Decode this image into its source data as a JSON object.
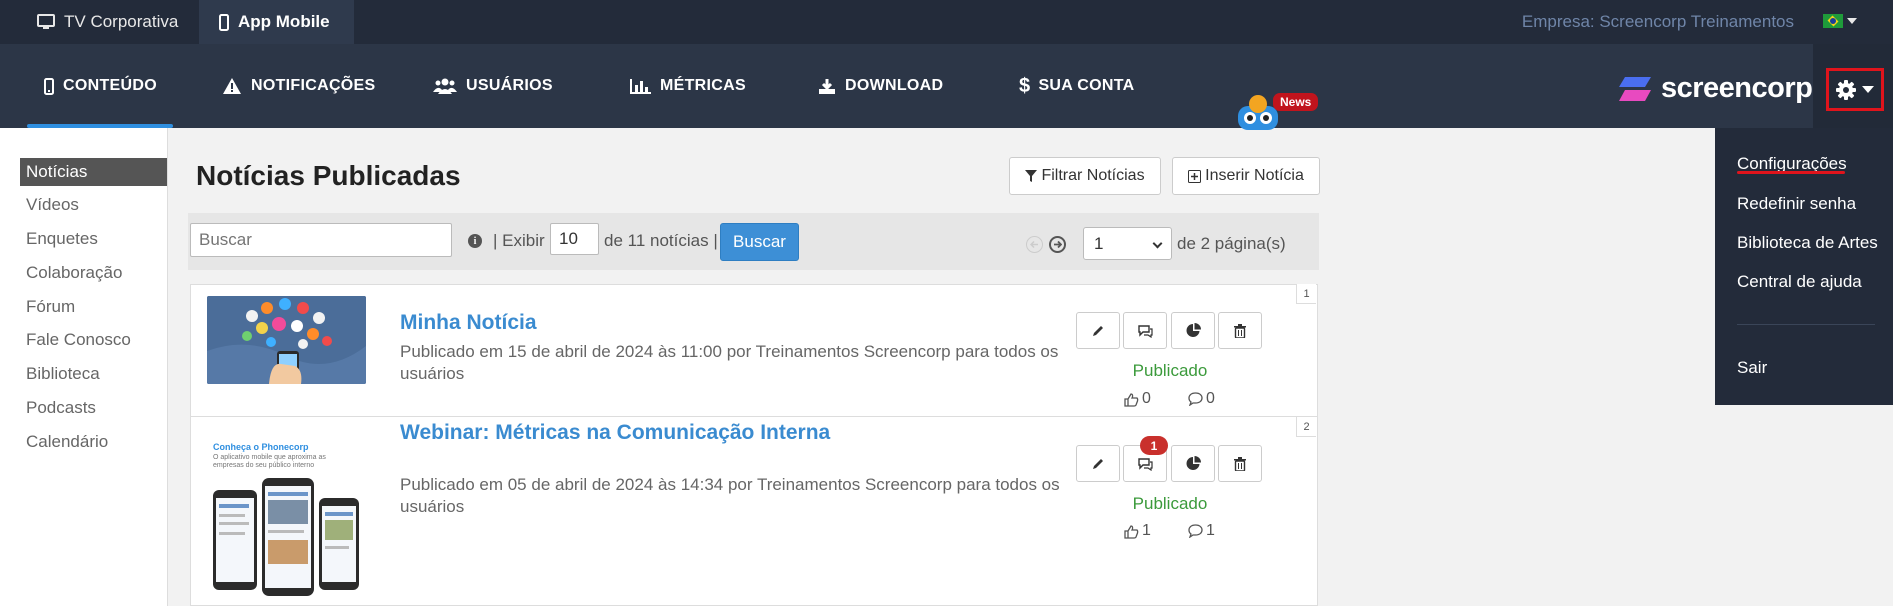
{
  "topbar": {
    "tabs": [
      {
        "label": "TV Corporativa",
        "icon": "monitor-icon"
      },
      {
        "label": "App Mobile",
        "icon": "phone-icon",
        "active": true
      }
    ],
    "company": "Empresa: Screencorp Treinamentos",
    "language_flag": "brazil-flag-icon"
  },
  "nav": {
    "items": [
      {
        "label": "CONTEÚDO",
        "icon": "mobile-icon",
        "active": true
      },
      {
        "label": "NOTIFICAÇÕES",
        "icon": "warning-icon"
      },
      {
        "label": "USUÁRIOS",
        "icon": "users-icon"
      },
      {
        "label": "MÉTRICAS",
        "icon": "bar-chart-icon"
      },
      {
        "label": "DOWNLOAD",
        "icon": "download-icon"
      },
      {
        "label": "SUA CONTA",
        "icon": "dollar-icon"
      }
    ],
    "news_badge": "News",
    "brand": "screencorp",
    "accent": "#2f8fe0"
  },
  "sidebar": {
    "items": [
      {
        "label": "Notícias",
        "active": true
      },
      {
        "label": "Vídeos"
      },
      {
        "label": "Enquetes"
      },
      {
        "label": "Colaboração"
      },
      {
        "label": "Fórum"
      },
      {
        "label": "Fale Conosco"
      },
      {
        "label": "Biblioteca"
      },
      {
        "label": "Podcasts"
      },
      {
        "label": "Calendário"
      }
    ]
  },
  "main": {
    "title": "Notícias Publicadas",
    "filter_label": "Filtrar Notícias",
    "insert_label": "Inserir Notícia",
    "search": {
      "placeholder": "Buscar",
      "show_label": "| Exibir",
      "count_value": "10",
      "count_suffix": "de 11 notícias |",
      "button": "Buscar",
      "page_value": "1",
      "page_suffix": "de 2 página(s)"
    },
    "news": [
      {
        "index": "1",
        "title": "Minha Notícia",
        "meta": "Publicado em 15 de abril de 2024 às 11:00 por Treinamentos Screencorp para todos os usuários",
        "status": "Publicado",
        "likes": "0",
        "comments": "0",
        "comment_badge": ""
      },
      {
        "index": "2",
        "title": "Webinar: Métricas na Comunicação Interna",
        "meta": "Publicado em 05 de abril de 2024 às 14:34 por Treinamentos Screencorp para todos os usuários",
        "status": "Publicado",
        "likes": "1",
        "comments": "1",
        "comment_badge": "1",
        "thumb_heading": "Conheça o Phonecorp",
        "thumb_text": "O aplicativo mobile que aproxima as empresas do seu público interno"
      }
    ]
  },
  "settings_menu": {
    "items": [
      "Configurações",
      "Redefinir senha",
      "Biblioteca de Artes",
      "Central de ajuda",
      "Sair"
    ],
    "highlight": "#e0141c"
  }
}
